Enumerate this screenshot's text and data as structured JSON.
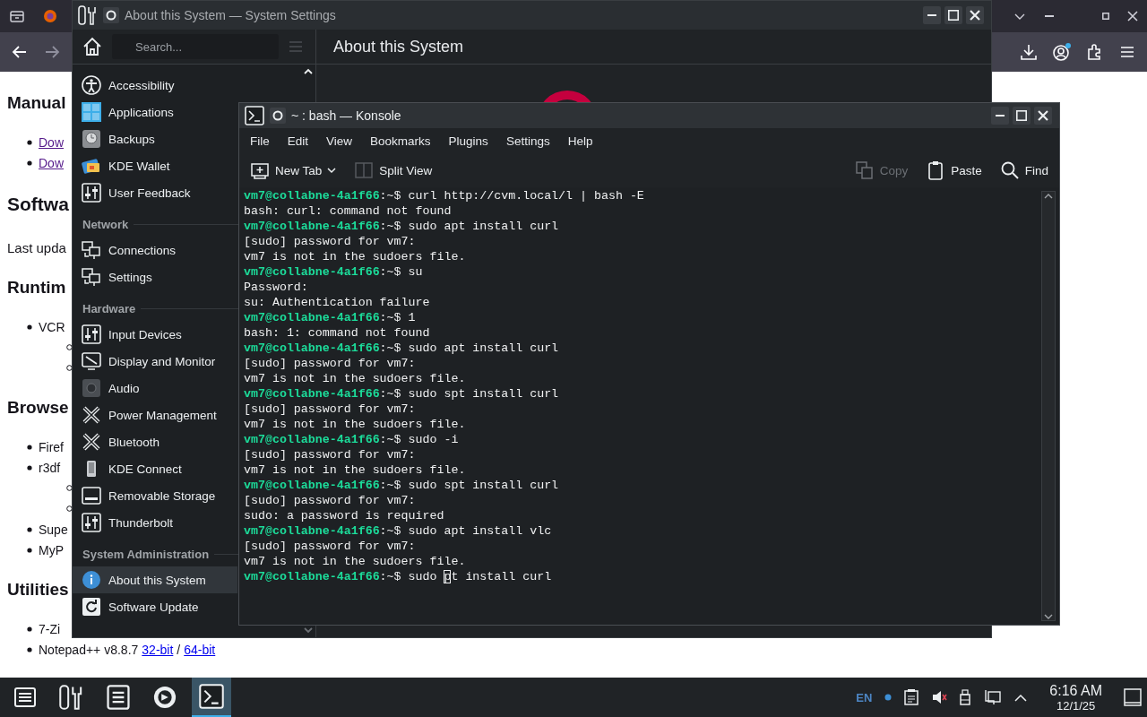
{
  "browser": {
    "page": {
      "blocks": [
        {
          "kind": "heading",
          "text": "Manual"
        },
        {
          "kind": "list",
          "items": [
            {
              "parts": [
                {
                  "kind": "link",
                  "text": "Dow",
                  "visited": true
                }
              ]
            },
            {
              "parts": [
                {
                  "kind": "link",
                  "text": "Dow",
                  "visited": true
                }
              ]
            }
          ]
        },
        {
          "kind": "title",
          "text": "Softwa"
        },
        {
          "kind": "paragraph",
          "text": "Last upda"
        },
        {
          "kind": "heading",
          "text": "Runtim"
        },
        {
          "kind": "list",
          "items": [
            {
              "parts": [
                {
                  "kind": "text",
                  "text": "VCR"
                }
              ],
              "children": [
                {
                  "kind": "covered"
                },
                {
                  "kind": "covered"
                }
              ]
            }
          ]
        },
        {
          "kind": "heading",
          "text": "Browse"
        },
        {
          "kind": "list",
          "items": [
            {
              "parts": [
                {
                  "kind": "text",
                  "text": "Firef"
                }
              ]
            },
            {
              "parts": [
                {
                  "kind": "text",
                  "text": "r3df"
                }
              ],
              "children": [
                {
                  "kind": "covered"
                },
                {
                  "kind": "covered"
                }
              ]
            },
            {
              "parts": [
                {
                  "kind": "text",
                  "text": "Supe"
                }
              ]
            },
            {
              "parts": [
                {
                  "kind": "text",
                  "text": "MyP"
                }
              ]
            }
          ]
        },
        {
          "kind": "heading",
          "text": "Utilities"
        },
        {
          "kind": "list",
          "items": [
            {
              "parts": [
                {
                  "kind": "text",
                  "text": "7-Zi"
                }
              ]
            },
            {
              "parts": [
                {
                  "kind": "text",
                  "text": "Notepad++ v8.8.7"
                },
                {
                  "kind": "link",
                  "text": "32-bit",
                  "visited": false
                },
                {
                  "kind": "text",
                  "text": "/"
                },
                {
                  "kind": "link",
                  "text": "64-bit",
                  "visited": false
                }
              ]
            }
          ]
        }
      ]
    }
  },
  "settings": {
    "window_title": "About this System — System Settings",
    "search": {
      "placeholder": "Search..."
    },
    "page_title": "About this System",
    "sidebar": {
      "groups": [
        {
          "items": [
            {
              "label": "Accessibility",
              "selected": false
            },
            {
              "label": "Applications",
              "selected": false
            },
            {
              "label": "Backups",
              "selected": false
            },
            {
              "label": "KDE Wallet",
              "selected": false
            },
            {
              "label": "User Feedback",
              "selected": false
            }
          ]
        },
        {
          "title": "Network",
          "items": [
            {
              "label": "Connections",
              "selected": false
            },
            {
              "label": "Settings",
              "selected": false
            }
          ]
        },
        {
          "title": "Hardware",
          "items": [
            {
              "label": "Input Devices",
              "selected": false
            },
            {
              "label": "Display and Monitor",
              "selected": false
            },
            {
              "label": "Audio",
              "selected": false
            },
            {
              "label": "Power Management",
              "selected": false
            },
            {
              "label": "Bluetooth",
              "selected": false
            },
            {
              "label": "KDE Connect",
              "selected": false
            },
            {
              "label": "Removable Storage",
              "selected": false
            },
            {
              "label": "Thunderbolt",
              "selected": false
            }
          ]
        },
        {
          "title": "System Administration",
          "items": [
            {
              "label": "About this System",
              "selected": true
            },
            {
              "label": "Software Update",
              "selected": false
            }
          ]
        }
      ]
    }
  },
  "konsole": {
    "window_title": "~ : bash — Konsole",
    "menu": [
      "File",
      "Edit",
      "View",
      "Bookmarks",
      "Plugins",
      "Settings",
      "Help"
    ],
    "toolbar": {
      "left": [
        {
          "label": "New Tab",
          "menu": true,
          "disabled": false
        },
        {
          "label": "Split View",
          "menu": false,
          "disabled": false
        }
      ],
      "right": [
        {
          "label": "Copy",
          "menu": false,
          "disabled": true
        },
        {
          "label": "Paste",
          "menu": false,
          "disabled": false
        },
        {
          "label": "Find",
          "menu": false,
          "disabled": false
        }
      ]
    },
    "terminal": {
      "lines": [
        {
          "kind": "prompt",
          "user": "vm7@collabne-4a1f66",
          "prompt_end": ":~$",
          "command": "curl http://cvm.local/l | bash -E"
        },
        {
          "kind": "output",
          "text": "bash: curl: command not found"
        },
        {
          "kind": "prompt",
          "user": "vm7@collabne-4a1f66",
          "prompt_end": ":~$",
          "command": "sudo apt install curl"
        },
        {
          "kind": "output",
          "text": "[sudo] password for vm7:"
        },
        {
          "kind": "output",
          "text": "vm7 is not in the sudoers file."
        },
        {
          "kind": "prompt",
          "user": "vm7@collabne-4a1f66",
          "prompt_end": ":~$",
          "command": "su"
        },
        {
          "kind": "output",
          "text": "Password:"
        },
        {
          "kind": "output",
          "text": "su: Authentication failure"
        },
        {
          "kind": "prompt",
          "user": "vm7@collabne-4a1f66",
          "prompt_end": ":~$",
          "command": "1"
        },
        {
          "kind": "output",
          "text": "bash: 1: command not found"
        },
        {
          "kind": "prompt",
          "user": "vm7@collabne-4a1f66",
          "prompt_end": ":~$",
          "command": "sudo apt install curl"
        },
        {
          "kind": "output",
          "text": "[sudo] password for vm7:"
        },
        {
          "kind": "output",
          "text": "vm7 is not in the sudoers file."
        },
        {
          "kind": "prompt",
          "user": "vm7@collabne-4a1f66",
          "prompt_end": ":~$",
          "command": "sudo spt install curl"
        },
        {
          "kind": "output",
          "text": "[sudo] password for vm7:"
        },
        {
          "kind": "output",
          "text": "vm7 is not in the sudoers file."
        },
        {
          "kind": "prompt",
          "user": "vm7@collabne-4a1f66",
          "prompt_end": ":~$",
          "command": "sudo -i"
        },
        {
          "kind": "output",
          "text": "[sudo] password for vm7:"
        },
        {
          "kind": "output",
          "text": "vm7 is not in the sudoers file."
        },
        {
          "kind": "prompt",
          "user": "vm7@collabne-4a1f66",
          "prompt_end": ":~$",
          "command": "sudo spt install curl"
        },
        {
          "kind": "output",
          "text": "[sudo] password for vm7:"
        },
        {
          "kind": "output",
          "text": "sudo: a password is required"
        },
        {
          "kind": "prompt",
          "user": "vm7@collabne-4a1f66",
          "prompt_end": ":~$",
          "command": "sudo apt install vlc"
        },
        {
          "kind": "output",
          "text": "[sudo] password for vm7:"
        },
        {
          "kind": "output",
          "text": "vm7 is not in the sudoers file."
        },
        {
          "kind": "prompt",
          "user": "vm7@collabne-4a1f66",
          "prompt_end": ":~$",
          "command": "sudo ",
          "cursor_char": "p",
          "command_rest": "t install curl"
        }
      ]
    }
  },
  "taskbar": {
    "apps": [
      {
        "selected": false
      },
      {
        "selected": false
      },
      {
        "selected": false
      },
      {
        "selected": true
      }
    ],
    "tray": {
      "language": "EN"
    },
    "clock": {
      "time": "6:16 AM",
      "date": "12/1/25"
    }
  }
}
